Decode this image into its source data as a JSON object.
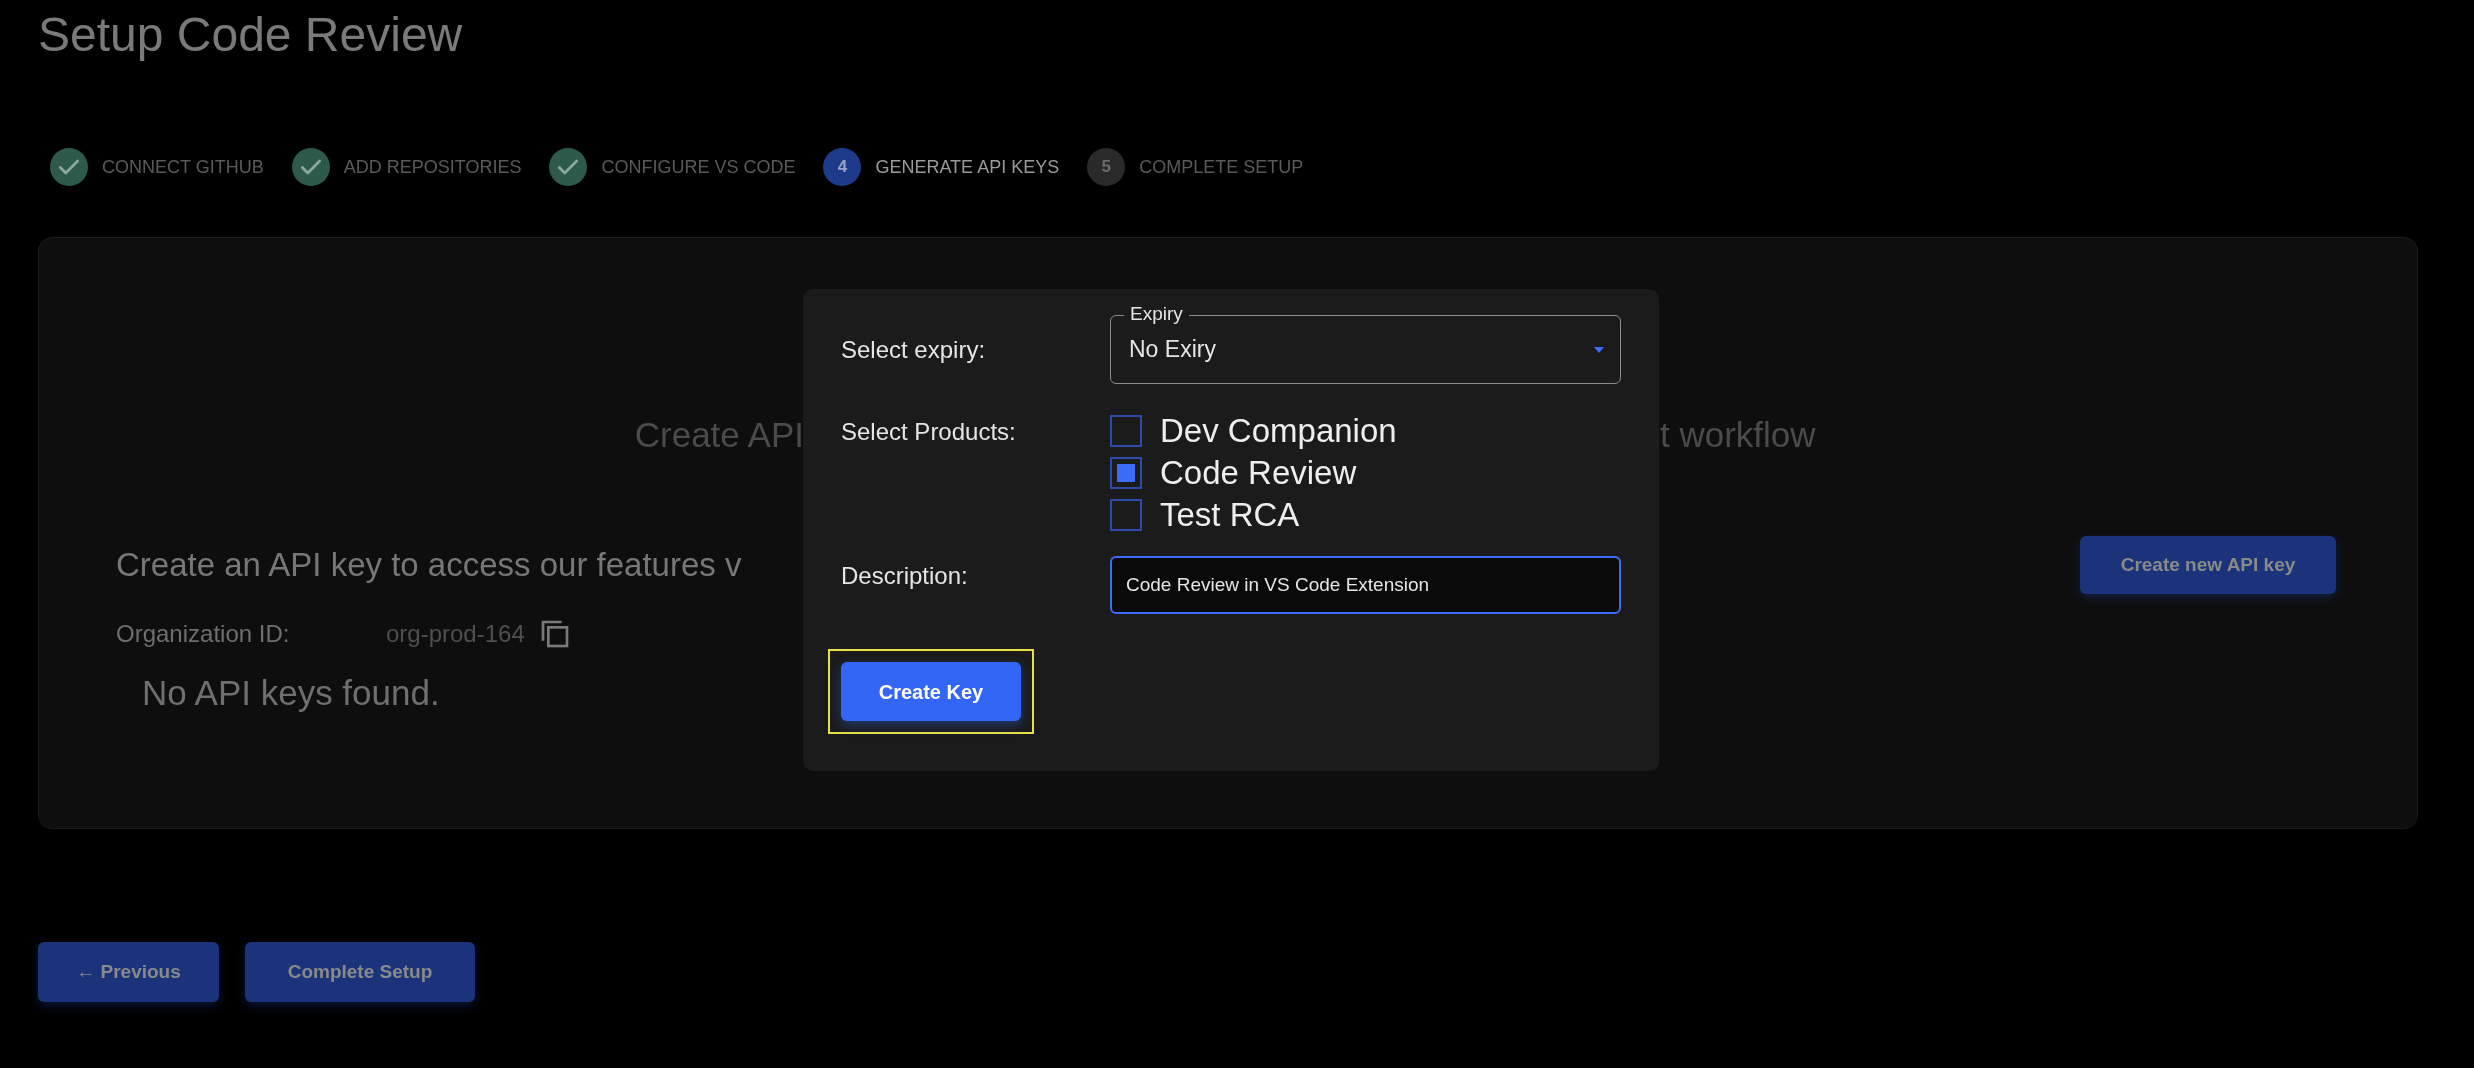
{
  "page": {
    "title": "Setup Code Review"
  },
  "steps": [
    {
      "label": "CONNECT GITHUB",
      "kind": "done"
    },
    {
      "label": "ADD REPOSITORIES",
      "kind": "done"
    },
    {
      "label": "CONFIGURE VS CODE",
      "kind": "done"
    },
    {
      "number": "4",
      "label": "GENERATE API KEYS",
      "kind": "current"
    },
    {
      "number": "5",
      "label": "COMPLETE SETUP",
      "kind": "pending"
    }
  ],
  "card": {
    "heading_left": "Create API",
    "heading_right": "t workflow",
    "intro": "Create an API key to access our features v",
    "org_label": "Organization ID:",
    "org_id": "org-prod-164",
    "empty": "No API keys found.",
    "create_button": "Create new API key"
  },
  "dialog": {
    "expiry_label": "Select expiry:",
    "expiry_legend": "Expiry",
    "expiry_value": "No Exiry",
    "products_label": "Select Products:",
    "products": [
      {
        "label": "Dev Companion",
        "checked": false
      },
      {
        "label": "Code Review",
        "checked": true
      },
      {
        "label": "Test RCA",
        "checked": false
      }
    ],
    "description_label": "Description:",
    "description_value": "Code Review in VS Code Extension",
    "create_button": {
      "label": "Create Key",
      "highlighted": true
    }
  },
  "footer": {
    "buttons": [
      "← Previous",
      "Complete Setup"
    ]
  }
}
